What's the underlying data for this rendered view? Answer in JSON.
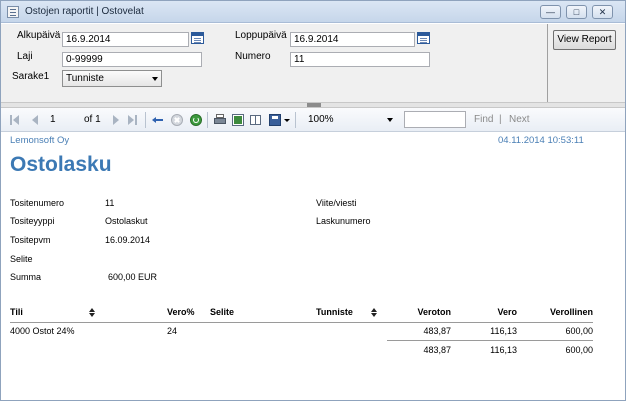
{
  "window": {
    "title": "Ostojen raportit | Ostovelat",
    "controls": {
      "minimize": "—",
      "maximize": "□",
      "close": "✕"
    }
  },
  "params": {
    "alkupaiva_label": "Alkupäivä",
    "alkupaiva_value": "16.9.2014",
    "loppupaiva_label": "Loppupäivä",
    "loppupaiva_value": "16.9.2014",
    "laji_label": "Laji",
    "laji_value": "0-99999",
    "numero_label": "Numero",
    "numero_value": "11",
    "sarake1_label": "Sarake1",
    "sarake1_value": "Tunniste",
    "view_report_label": "View Report"
  },
  "toolbar": {
    "page_value": "1",
    "of_label": "of 1",
    "zoom_value": "100%",
    "find_label": "Find",
    "separator": "|",
    "next_label": "Next"
  },
  "report": {
    "company": "Lemonsoft Oy",
    "timestamp": "04.11.2014 10:53:11",
    "title": "Ostolasku",
    "fields": {
      "tositenumero_label": "Tositenumero",
      "tositenumero_value": "11",
      "tositeyyppi_label": "Tositeyyppi",
      "tositeyyppi_value": "Ostolaskut",
      "tositepvm_label": "Tositepvm",
      "tositepvm_value": "16.09.2014",
      "selite_label": "Selite",
      "summa_label": "Summa",
      "summa_value": "600,00 EUR",
      "viite_label": "Viite/viesti",
      "laskunumero_label": "Laskunumero"
    },
    "table": {
      "headers": {
        "tili": "Tili",
        "vero_pct": "Vero%",
        "selite": "Selite",
        "tunniste": "Tunniste",
        "veroton": "Veroton",
        "vero": "Vero",
        "verollinen": "Verollinen"
      },
      "rows": [
        {
          "tili": "4000 Ostot 24%",
          "vero_pct": "24",
          "veroton": "483,87",
          "vero": "116,13",
          "verollinen": "600,00"
        }
      ],
      "totals": {
        "veroton": "483,87",
        "vero": "116,13",
        "verollinen": "600,00"
      }
    }
  },
  "colors": {
    "accent": "#3c79b4",
    "header_link": "#4a7fb5",
    "toolbar_icon": "#a9b4c2"
  }
}
